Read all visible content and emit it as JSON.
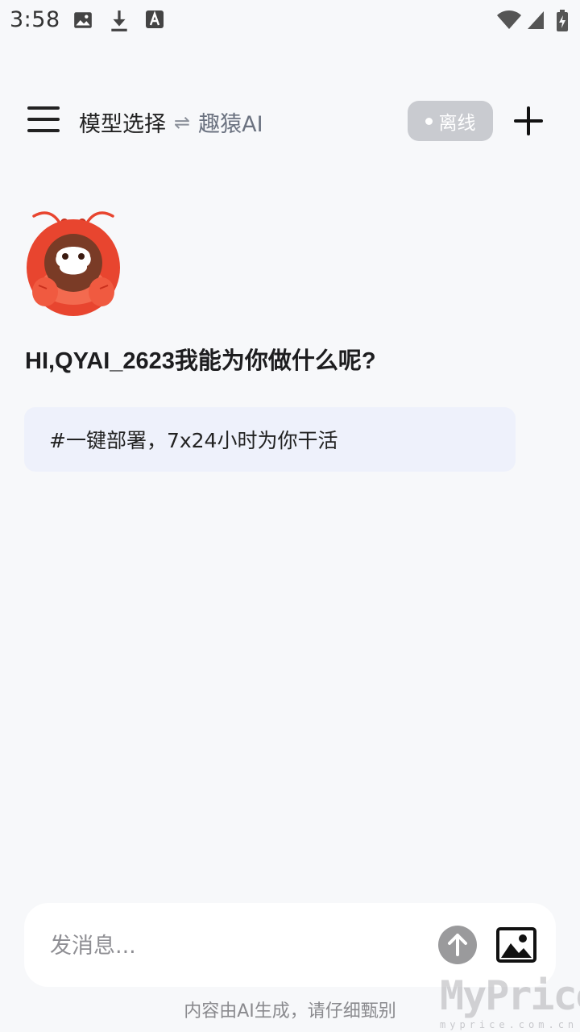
{
  "status_bar": {
    "time": "3:58",
    "icons": [
      "image-icon",
      "download-icon",
      "font-icon",
      "wifi-icon",
      "signal-icon",
      "battery-charging-icon"
    ]
  },
  "header": {
    "title": "模型选择",
    "swap_symbol": "⇌",
    "model_name": "趣猿AI",
    "status_label": "离线",
    "colors": {
      "pill_bg": "#c9cbd0"
    }
  },
  "main": {
    "greeting": "HI,QYAI_2623我能为你做什么呢?",
    "suggestion": "#一键部署，7x24小时为你干活"
  },
  "composer": {
    "placeholder": "发消息..."
  },
  "footer": {
    "disclaimer": "内容由AI生成，请仔细甄别"
  },
  "watermark": {
    "text": "MyPrice",
    "sub": "myprice.com.cn"
  },
  "colors": {
    "background": "#f7f8fa",
    "suggestion_bg": "#eef1fb",
    "mascot_primary": "#e8452f",
    "send_button": "#9a9a9c"
  }
}
